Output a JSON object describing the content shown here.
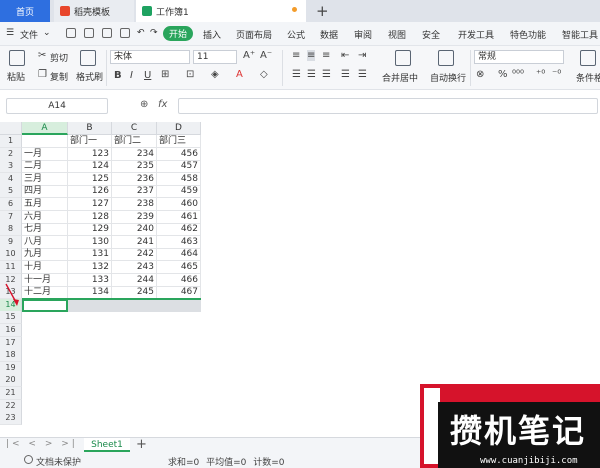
{
  "tabs": {
    "home": "首页",
    "docer": "稻壳模板",
    "workbook": "工作簿1"
  },
  "menu": {
    "file": "文件",
    "start": "开始",
    "items": [
      "插入",
      "页面布局",
      "公式",
      "数据",
      "审阅",
      "视图",
      "安全",
      "开发工具",
      "特色功能",
      "智能工具"
    ]
  },
  "ribbon": {
    "paste": "粘贴",
    "cut": "剪切",
    "copy": "复制",
    "format_painter": "格式刷",
    "font_name": "宋体",
    "font_size": "11",
    "merge_center": "合并居中",
    "wrap_text": "自动换行",
    "number_format": "常规",
    "conditional_format": "条件格"
  },
  "formula_bar": {
    "name_box": "A14",
    "fx": "fx",
    "value": ""
  },
  "columns": [
    "A",
    "B",
    "C",
    "D"
  ],
  "rows": [
    [
      "",
      "部门一",
      "部门二",
      "部门三"
    ],
    [
      "一月",
      "123",
      "234",
      "456"
    ],
    [
      "二月",
      "124",
      "235",
      "457"
    ],
    [
      "三月",
      "125",
      "236",
      "458"
    ],
    [
      "四月",
      "126",
      "237",
      "459"
    ],
    [
      "五月",
      "127",
      "238",
      "460"
    ],
    [
      "六月",
      "128",
      "239",
      "461"
    ],
    [
      "七月",
      "129",
      "240",
      "462"
    ],
    [
      "八月",
      "130",
      "241",
      "463"
    ],
    [
      "九月",
      "131",
      "242",
      "464"
    ],
    [
      "十月",
      "132",
      "243",
      "465"
    ],
    [
      "十一月",
      "133",
      "244",
      "466"
    ],
    [
      "十二月",
      "134",
      "245",
      "467"
    ]
  ],
  "row_numbers": [
    "1",
    "2",
    "3",
    "4",
    "5",
    "6",
    "7",
    "8",
    "9",
    "10",
    "11",
    "12",
    "13",
    "14",
    "15",
    "16",
    "17",
    "18",
    "19",
    "20",
    "21",
    "22",
    "23"
  ],
  "active_row": "14",
  "sheet": {
    "name": "Sheet1"
  },
  "status": {
    "protect": "文档未保护",
    "stats": "求和=0 平均值=0 计数=0"
  },
  "watermark": {
    "text": "攒机笔记",
    "url": "www.cuanjibiji.com"
  },
  "colors": {
    "accent_green": "#2aa55c",
    "home_tab": "#2e6fe0",
    "watermark_red": "#d6132b"
  }
}
